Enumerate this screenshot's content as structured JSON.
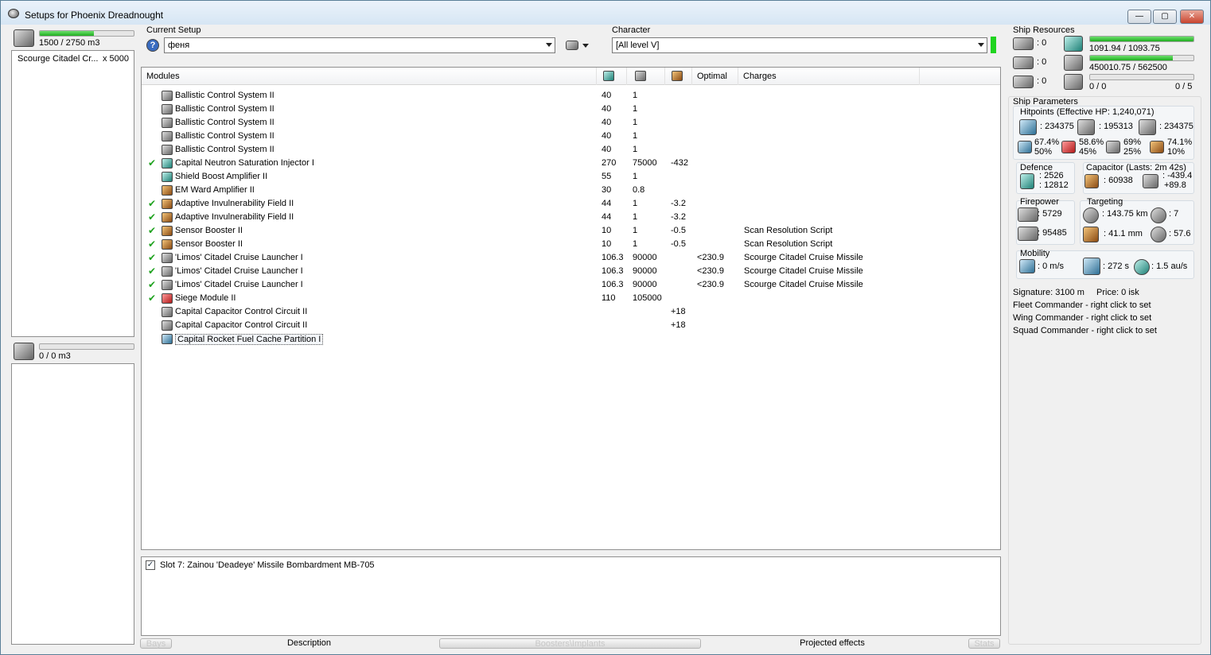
{
  "window": {
    "title": "Setups for Phoenix Dreadnought",
    "min": "—",
    "max": "▢",
    "close": "✕"
  },
  "cargo": {
    "capacity_text": "1500 / 2750 m3",
    "fill_pct": 58,
    "item_name": "Scourge Citadel Cr...",
    "item_qty": "x 5000"
  },
  "drones": {
    "capacity_text": "0 / 0 m3",
    "fill_pct": 0
  },
  "setup": {
    "label": "Current Setup",
    "value": "феня",
    "help": "?"
  },
  "character": {
    "label": "Character",
    "value": "[All level V]"
  },
  "modules": {
    "columns": [
      "Modules",
      "",
      "",
      "",
      "Optimal",
      "Charges"
    ],
    "rows": [
      {
        "name": "Ballistic Control System II",
        "cpu": "40",
        "pg": "1",
        "cap": "",
        "optimal": "",
        "charges": "",
        "online": false,
        "icon": "gray"
      },
      {
        "name": "Ballistic Control System II",
        "cpu": "40",
        "pg": "1",
        "cap": "",
        "optimal": "",
        "charges": "",
        "online": false,
        "icon": "gray"
      },
      {
        "name": "Ballistic Control System II",
        "cpu": "40",
        "pg": "1",
        "cap": "",
        "optimal": "",
        "charges": "",
        "online": false,
        "icon": "gray"
      },
      {
        "name": "Ballistic Control System II",
        "cpu": "40",
        "pg": "1",
        "cap": "",
        "optimal": "",
        "charges": "",
        "online": false,
        "icon": "gray"
      },
      {
        "name": "Ballistic Control System II",
        "cpu": "40",
        "pg": "1",
        "cap": "",
        "optimal": "",
        "charges": "",
        "online": false,
        "icon": "gray"
      },
      {
        "name": "Capital Neutron Saturation Injector I",
        "cpu": "270",
        "pg": "75000",
        "cap": "-432",
        "optimal": "",
        "charges": "",
        "online": true,
        "icon": "teal"
      },
      {
        "name": "Shield Boost Amplifier II",
        "cpu": "55",
        "pg": "1",
        "cap": "",
        "optimal": "",
        "charges": "",
        "online": false,
        "icon": "teal"
      },
      {
        "name": "EM Ward Amplifier II",
        "cpu": "30",
        "pg": "0.8",
        "cap": "",
        "optimal": "",
        "charges": "",
        "online": false,
        "icon": "orange"
      },
      {
        "name": "Adaptive Invulnerability Field II",
        "cpu": "44",
        "pg": "1",
        "cap": "-3.2",
        "optimal": "",
        "charges": "",
        "online": true,
        "icon": "orange"
      },
      {
        "name": "Adaptive Invulnerability Field II",
        "cpu": "44",
        "pg": "1",
        "cap": "-3.2",
        "optimal": "",
        "charges": "",
        "online": true,
        "icon": "orange"
      },
      {
        "name": "Sensor Booster II",
        "cpu": "10",
        "pg": "1",
        "cap": "-0.5",
        "optimal": "",
        "charges": "Scan Resolution Script",
        "online": true,
        "icon": "orange"
      },
      {
        "name": "Sensor Booster II",
        "cpu": "10",
        "pg": "1",
        "cap": "-0.5",
        "optimal": "",
        "charges": "Scan Resolution Script",
        "online": true,
        "icon": "orange"
      },
      {
        "name": "'Limos' Citadel Cruise Launcher I",
        "cpu": "106.3",
        "pg": "90000",
        "cap": "",
        "optimal": "<230.9",
        "charges": "Scourge Citadel Cruise Missile",
        "online": true,
        "icon": "gray"
      },
      {
        "name": "'Limos' Citadel Cruise Launcher I",
        "cpu": "106.3",
        "pg": "90000",
        "cap": "",
        "optimal": "<230.9",
        "charges": "Scourge Citadel Cruise Missile",
        "online": true,
        "icon": "gray"
      },
      {
        "name": "'Limos' Citadel Cruise Launcher I",
        "cpu": "106.3",
        "pg": "90000",
        "cap": "",
        "optimal": "<230.9",
        "charges": "Scourge Citadel Cruise Missile",
        "online": true,
        "icon": "gray"
      },
      {
        "name": "Siege Module II",
        "cpu": "110",
        "pg": "105000",
        "cap": "",
        "optimal": "",
        "charges": "",
        "online": true,
        "icon": "red"
      },
      {
        "name": "Capital Capacitor Control Circuit II",
        "cpu": "",
        "pg": "",
        "cap": "+18",
        "optimal": "",
        "charges": "",
        "online": false,
        "icon": "gray"
      },
      {
        "name": "Capital Capacitor Control Circuit II",
        "cpu": "",
        "pg": "",
        "cap": "+18",
        "optimal": "",
        "charges": "",
        "online": false,
        "icon": "gray"
      },
      {
        "name": "Capital Rocket Fuel Cache Partition I",
        "cpu": "",
        "pg": "",
        "cap": "",
        "optimal": "",
        "charges": "",
        "online": false,
        "icon": "blue"
      }
    ]
  },
  "implant": {
    "text": "Slot 7: Zainou 'Deadeye' Missile Bombardment MB-705",
    "checked": true
  },
  "bottom_tabs": {
    "bays": "Bays",
    "description": "Description",
    "boosters": "Boosters\\Implants",
    "projected": "Projected effects",
    "stats": "Stats"
  },
  "resources": {
    "title": "Ship Resources",
    "turret_hardpoints": ": 0",
    "launcher_hardpoints": ": 0",
    "drone_hardpoints": ": 0",
    "cpu_text": "1091.94 / 1093.75",
    "cpu_fill_pct": 99.8,
    "pg_text": "450010.75 / 562500",
    "pg_fill_pct": 80,
    "calib_text": "0 / 0",
    "calib_max": "0 / 5",
    "calib_fill_pct": 0
  },
  "params": {
    "title": "Ship Parameters",
    "hitpoints_title": "Hitpoints (Effective HP: 1,240,071)",
    "shield_hp": ": 234375",
    "armor_hp": ": 195313",
    "hull_hp": ": 234375",
    "res_em": [
      "67.4%",
      "50%"
    ],
    "res_th": [
      "58.6%",
      "45%"
    ],
    "res_ki": [
      "69%",
      "25%"
    ],
    "res_ex": [
      "74.1%",
      "10%"
    ],
    "defence_title": "Defence",
    "defence_a": ": 2526",
    "defence_b": ": 12812",
    "cap_title": "Capacitor (Lasts: 2m 42s)",
    "cap_amount": ": 60938",
    "cap_a": ": -439.4",
    "cap_b": "+89.8",
    "firepower_title": "Firepower",
    "firepower_a": ": 5729",
    "firepower_b": ": 95485",
    "targeting_title": "Targeting",
    "range": ": 143.75 km",
    "targets": ": 7",
    "sensor": ": 41.1 mm",
    "scanres": ": 57.6",
    "mobility_title": "Mobility",
    "speed": ": 0 m/s",
    "align": ": 272 s",
    "warp": ": 1.5 au/s",
    "signature": "Signature: 3100 m",
    "price": "Price: 0 isk",
    "fleet_cmd": "Fleet Commander - right click to set",
    "wing_cmd": "Wing Commander - right click to set",
    "squad_cmd": "Squad Commander - right click to set"
  }
}
